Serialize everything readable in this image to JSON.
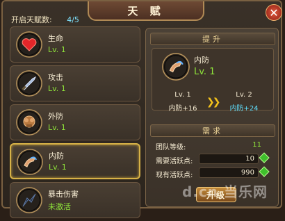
{
  "window": {
    "title": "天 赋"
  },
  "talent_count": {
    "label": "开启天赋数:",
    "value": "4/5"
  },
  "talents": [
    {
      "name": "生命",
      "level": "Lv. 1",
      "icon": "heart-icon"
    },
    {
      "name": "攻击",
      "level": "Lv. 1",
      "icon": "sword-icon"
    },
    {
      "name": "外防",
      "level": "Lv. 1",
      "icon": "armor-icon"
    },
    {
      "name": "内防",
      "level": "Lv. 1",
      "icon": "arm-shield-icon",
      "selected": true
    },
    {
      "name": "暴击伤害",
      "level": "未激活",
      "icon": "crit-icon"
    }
  ],
  "upgrade_panel": {
    "header": "提升",
    "current_name": "内防",
    "current_level": "Lv. 1",
    "from_level": "Lv. 1",
    "from_stat": "内防+16",
    "to_level": "Lv. 2",
    "to_stat": "内防+24"
  },
  "requirements": {
    "header": "需求",
    "team_level_label": "团队等级:",
    "team_level_value": "11",
    "need_points_label": "需要活跃点:",
    "need_points_value": "10",
    "have_points_label": "现有活跃点:",
    "have_points_value": "990"
  },
  "upgrade_button": "升级",
  "watermark": "d.cn 当乐网",
  "colors": {
    "accent_green": "#8fe43a",
    "accent_cyan": "#5fe0ff",
    "gold": "#d7b247"
  }
}
